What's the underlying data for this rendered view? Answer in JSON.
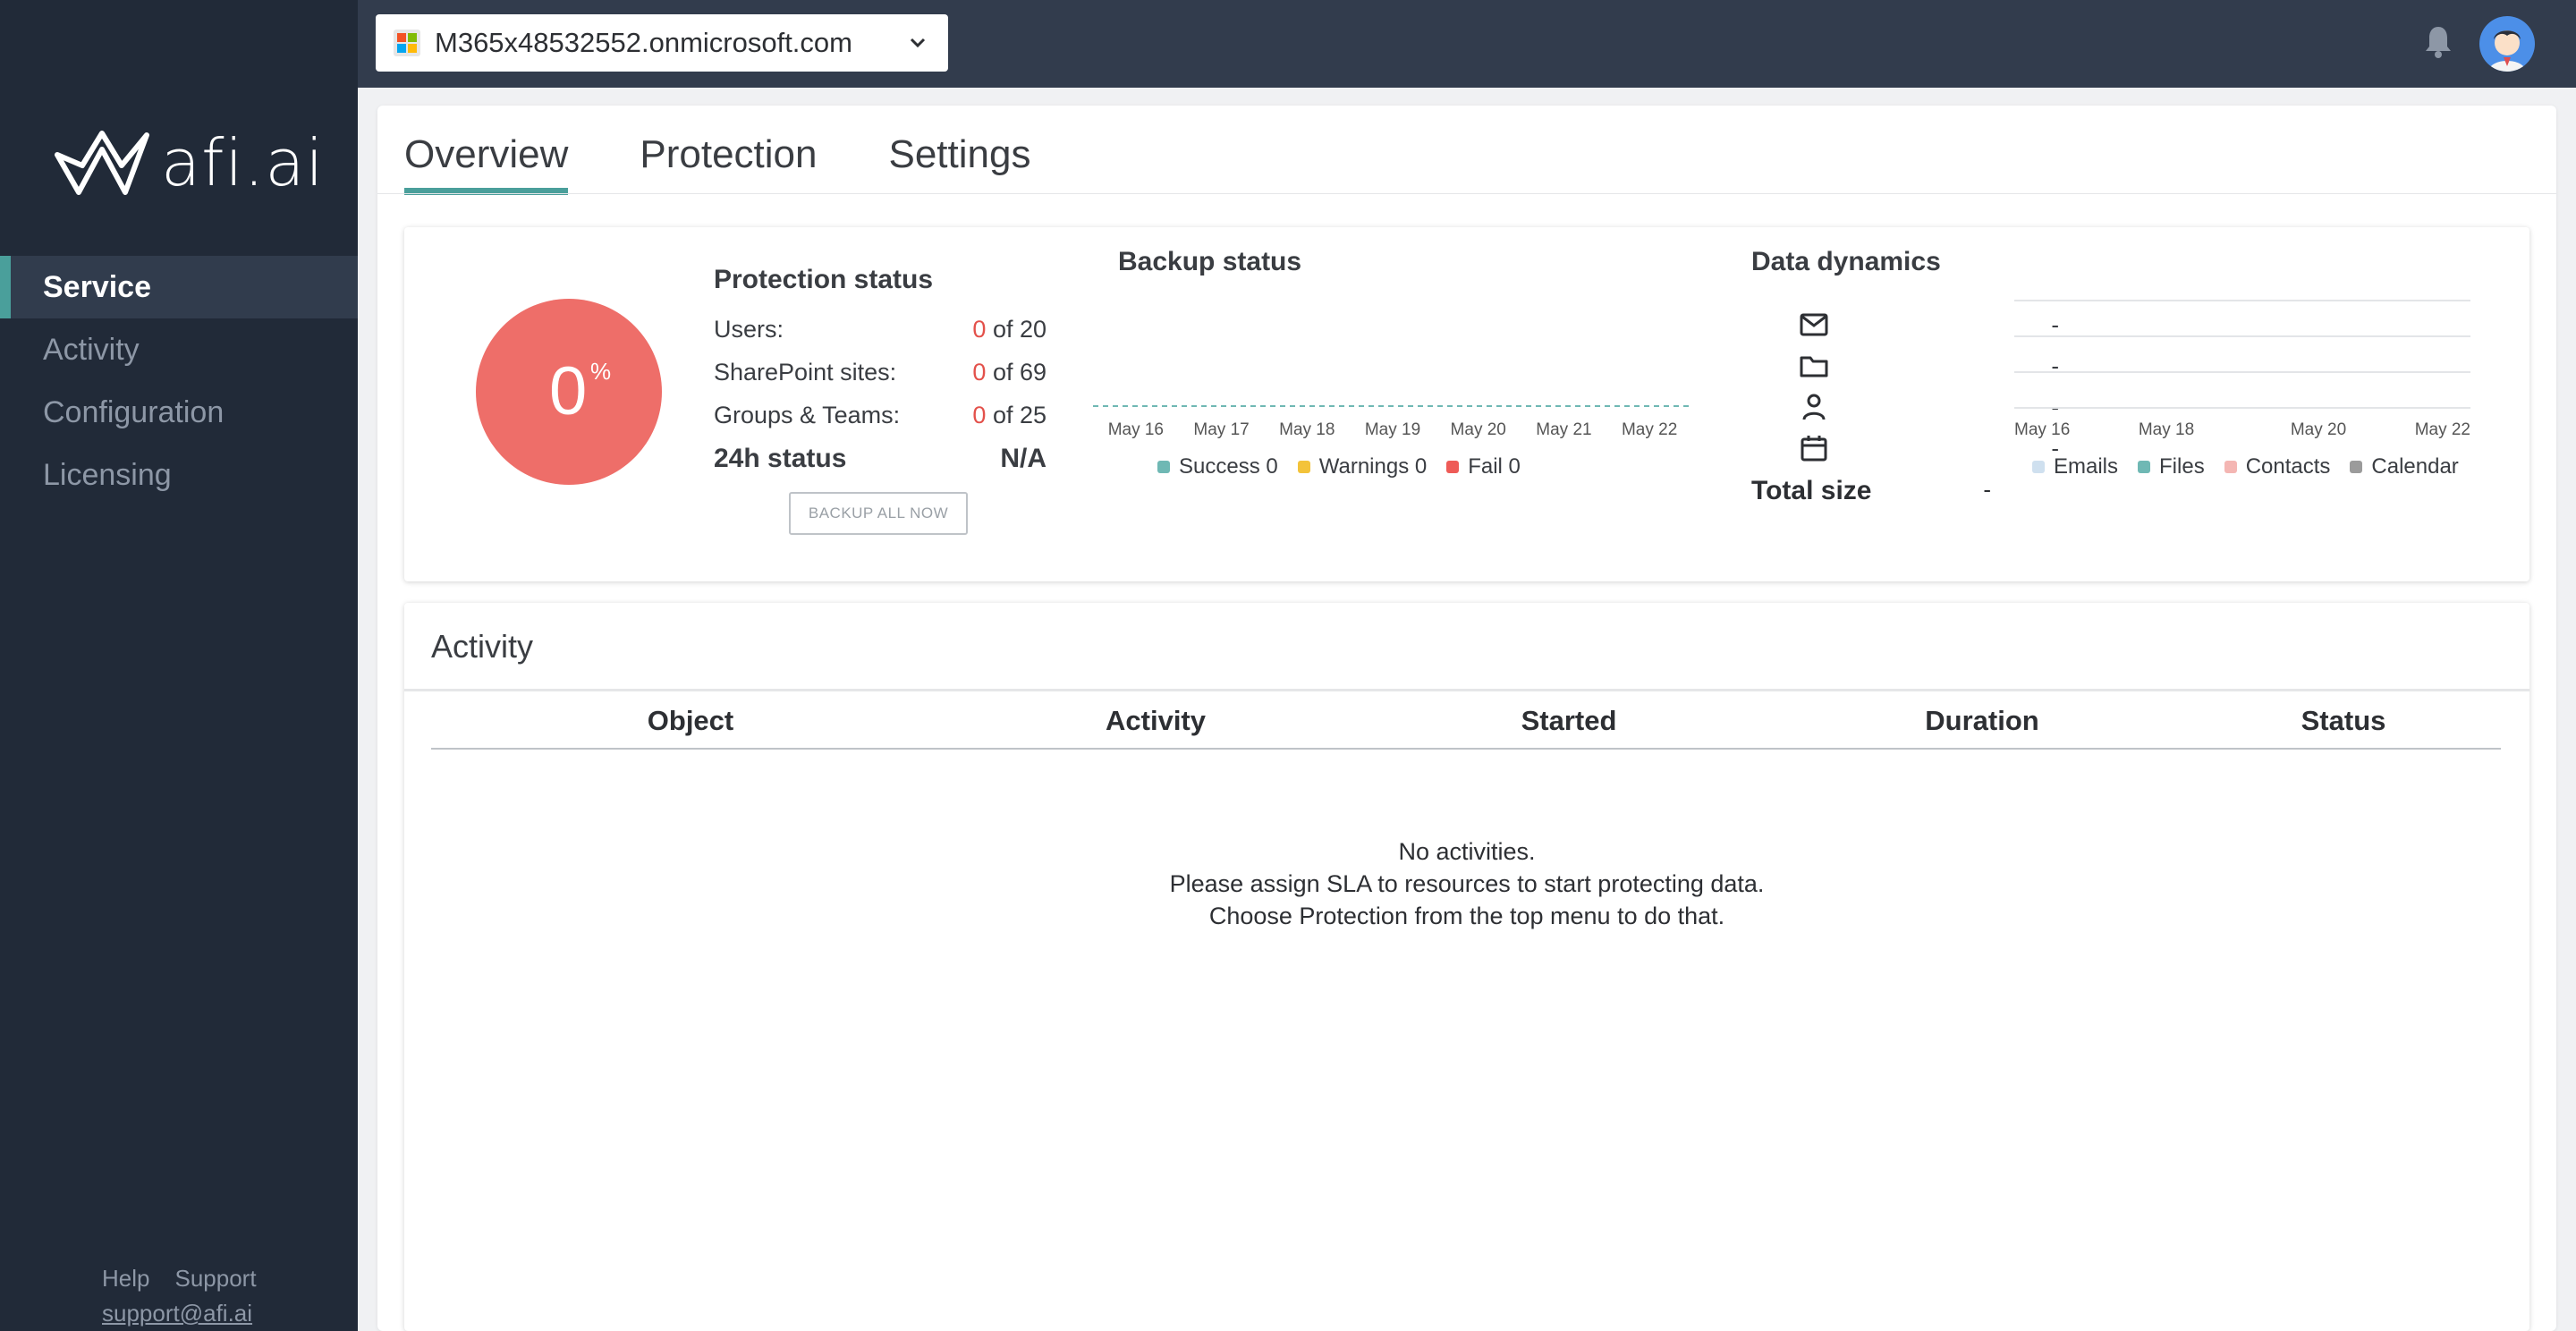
{
  "brand": {
    "logo_text": "afi.ai"
  },
  "sidebar": {
    "items": [
      {
        "label": "Service",
        "active": true
      },
      {
        "label": "Activity",
        "active": false
      },
      {
        "label": "Configuration",
        "active": false
      },
      {
        "label": "Licensing",
        "active": false
      }
    ],
    "footer": {
      "help": "Help",
      "support": "Support",
      "email": "support@afi.ai"
    }
  },
  "topbar": {
    "tenant": "M365x48532552.onmicrosoft.com",
    "icons": [
      "microsoft-logo",
      "chevron-down-icon",
      "bell-icon",
      "avatar"
    ]
  },
  "tabs": [
    {
      "label": "Overview",
      "active": true
    },
    {
      "label": "Protection",
      "active": false
    },
    {
      "label": "Settings",
      "active": false
    }
  ],
  "protection": {
    "percent": "0",
    "percent_sign": "%",
    "title": "Protection status",
    "rows": [
      {
        "label": "Users:",
        "count": "0",
        "of": "of 20"
      },
      {
        "label": "SharePoint sites:",
        "count": "0",
        "of": "of 69"
      },
      {
        "label": "Groups & Teams:",
        "count": "0",
        "of": "of 25"
      }
    ],
    "status_label": "24h status",
    "status_value": "N/A",
    "backup_button": "BACKUP ALL NOW"
  },
  "backup_status": {
    "title": "Backup status",
    "legend": [
      "Success 0",
      "Warnings 0",
      "Fail 0"
    ],
    "colors": [
      "#6fb8b4",
      "#f3c33a",
      "#ee5b57"
    ]
  },
  "data_dynamics": {
    "title": "Data dynamics",
    "rows": [
      {
        "icon": "mail-icon",
        "value": "-"
      },
      {
        "icon": "folder-icon",
        "value": "-"
      },
      {
        "icon": "person-icon",
        "value": "-"
      },
      {
        "icon": "calendar-icon",
        "value": "-"
      }
    ],
    "total_label": "Total size",
    "total_value": "-",
    "legend": [
      "Emails",
      "Files",
      "Contacts",
      "Calendar"
    ],
    "colors": [
      "#cfe0ef",
      "#6fb8b4",
      "#f4b6b3",
      "#9b9b9b"
    ]
  },
  "chart_data": [
    {
      "type": "line",
      "title": "Backup status",
      "x": [
        "May 16",
        "May 17",
        "May 18",
        "May 19",
        "May 20",
        "May 21",
        "May 22"
      ],
      "series": [
        {
          "name": "Success",
          "values": [
            0,
            0,
            0,
            0,
            0,
            0,
            0
          ]
        },
        {
          "name": "Warnings",
          "values": [
            0,
            0,
            0,
            0,
            0,
            0,
            0
          ]
        },
        {
          "name": "Fail",
          "values": [
            0,
            0,
            0,
            0,
            0,
            0,
            0
          ]
        }
      ]
    },
    {
      "type": "area",
      "title": "Data dynamics",
      "x": [
        "May 16",
        "May 18",
        "May 20",
        "May 22"
      ],
      "series": [
        {
          "name": "Emails",
          "values": [
            0,
            0,
            0,
            0
          ]
        },
        {
          "name": "Files",
          "values": [
            0,
            0,
            0,
            0
          ]
        },
        {
          "name": "Contacts",
          "values": [
            0,
            0,
            0,
            0
          ]
        },
        {
          "name": "Calendar",
          "values": [
            0,
            0,
            0,
            0
          ]
        }
      ],
      "grid": true
    }
  ],
  "activity": {
    "title": "Activity",
    "columns": [
      "Object",
      "Activity",
      "Started",
      "Duration",
      "Status"
    ],
    "empty": [
      "No activities.",
      "Please assign SLA to resources to start protecting data.",
      "Choose Protection from the top menu to do that."
    ]
  }
}
